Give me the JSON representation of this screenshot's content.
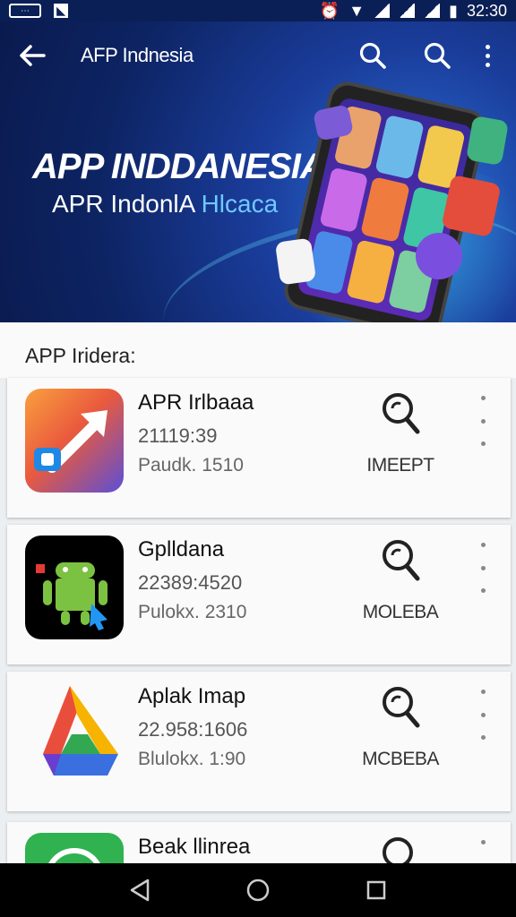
{
  "status_bar": {
    "time": "32:30",
    "left_icons": [
      "notification-box-icon",
      "app-notification-icon"
    ],
    "right_icons": [
      "alarm-icon",
      "wifi-icon",
      "signal-icon",
      "signal-icon",
      "signal-icon",
      "battery-icon"
    ]
  },
  "app_bar": {
    "title": "AFP Indnesia"
  },
  "hero": {
    "title": "APP INDDANESIA",
    "subtitle_main": "APR IndonlA ",
    "subtitle_accent": "Hlcaca"
  },
  "section": {
    "title": "APP Iridera:"
  },
  "apps": [
    {
      "name": "APR Irlbaaa",
      "meta1": "21119:39",
      "meta2": "Paudk. 1510",
      "action": "IMEEPT",
      "icon": "arrow-app-icon"
    },
    {
      "name": "Gplldana",
      "meta1": "22389:4520",
      "meta2": "Pulokx. 2310",
      "action": "MOLEBA",
      "icon": "android-robot-icon"
    },
    {
      "name": "Aplak Imap",
      "meta1": "22.958:1606",
      "meta2": "Blulokx. 1:90",
      "action": "MCBEBA",
      "icon": "triangle-drive-icon"
    },
    {
      "name": "Beak llinrea",
      "meta1": "",
      "meta2": "",
      "action": "",
      "icon": "green-app-icon"
    }
  ],
  "colors": {
    "banner_dark": "#0a1a4e",
    "banner_mid": "#1a3c9a",
    "accent_text": "#6fc9ff"
  }
}
